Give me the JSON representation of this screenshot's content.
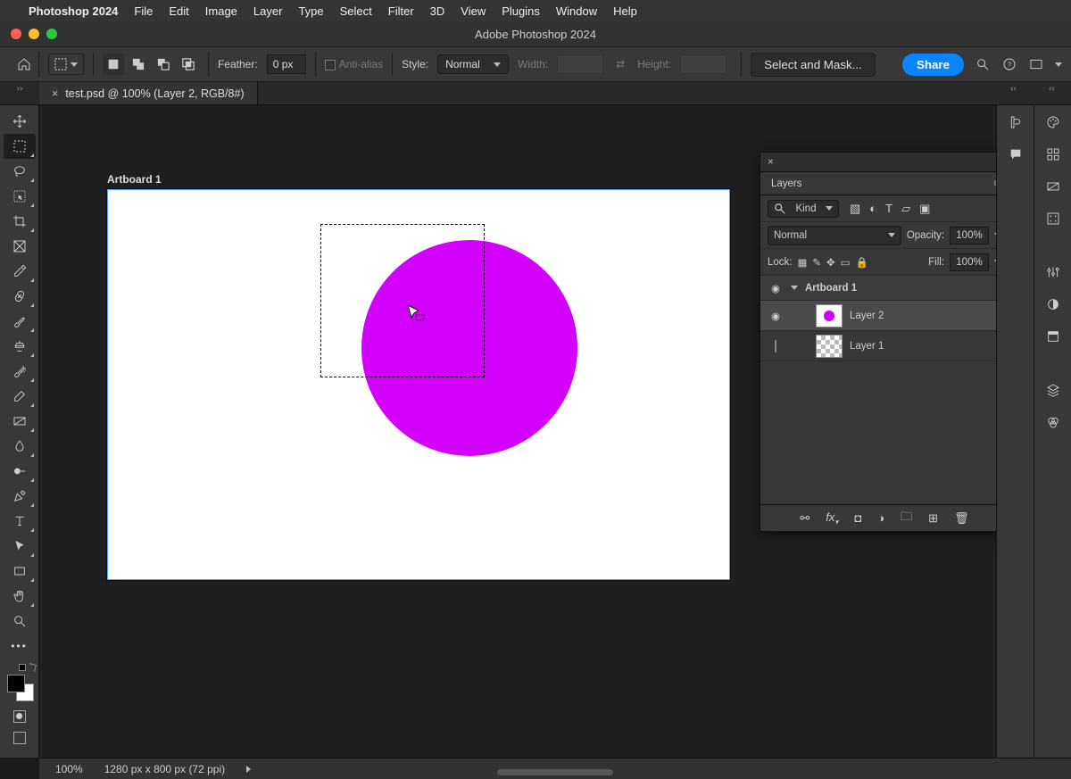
{
  "menubar": {
    "appname": "Photoshop 2024",
    "items": [
      "File",
      "Edit",
      "Image",
      "Layer",
      "Type",
      "Select",
      "Filter",
      "3D",
      "View",
      "Plugins",
      "Window",
      "Help"
    ]
  },
  "window": {
    "title": "Adobe Photoshop 2024"
  },
  "options": {
    "feather_label": "Feather:",
    "feather_value": "0 px",
    "antialias_label": "Anti-alias",
    "style_label": "Style:",
    "style_value": "Normal",
    "width_label": "Width:",
    "height_label": "Height:",
    "select_mask": "Select and Mask...",
    "share": "Share"
  },
  "tab": {
    "title": "test.psd @ 100% (Layer 2, RGB/8#)"
  },
  "artboard": {
    "label": "Artboard 1"
  },
  "layers_panel": {
    "title": "Layers",
    "kind": "Kind",
    "blend_mode": "Normal",
    "opacity_label": "Opacity:",
    "opacity_value": "100%",
    "lock_label": "Lock:",
    "fill_label": "Fill:",
    "fill_value": "100%",
    "artboard": "Artboard 1",
    "layers": [
      {
        "name": "Layer 2",
        "visible": true,
        "selected": true
      },
      {
        "name": "Layer 1",
        "visible": false,
        "selected": false
      }
    ]
  },
  "status": {
    "zoom": "100%",
    "docinfo": "1280 px x 800 px (72 ppi)"
  }
}
